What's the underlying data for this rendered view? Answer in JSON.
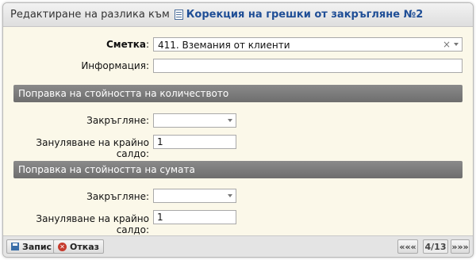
{
  "title": {
    "prefix": "Редактиране на разлика към",
    "link": "Корекция на грешки от закръгляне №2"
  },
  "form": {
    "account_label": "Сметка",
    "account_colon": ":",
    "account_value": "411. Вземания от клиенти",
    "clear_symbol": "×",
    "info_label": "Информация:",
    "info_value": ""
  },
  "section_quantity": {
    "title": "Поправка на стойността на количеството",
    "rounding_label": "Закръгляне:",
    "rounding_value": "",
    "zero_label": "Зануляване на крайно салдо:",
    "zero_value": "1"
  },
  "section_amount": {
    "title": "Поправка на стойността на сумата",
    "rounding_label": "Закръгляне:",
    "rounding_value": "",
    "zero_label": "Зануляване на крайно салдо:",
    "zero_value": "1"
  },
  "footer": {
    "save_label": "Запис",
    "cancel_label": "Отказ",
    "cancel_icon_glyph": "✕",
    "prev_label": "«««",
    "page_label": "4/13",
    "next_label": "»»»"
  }
}
